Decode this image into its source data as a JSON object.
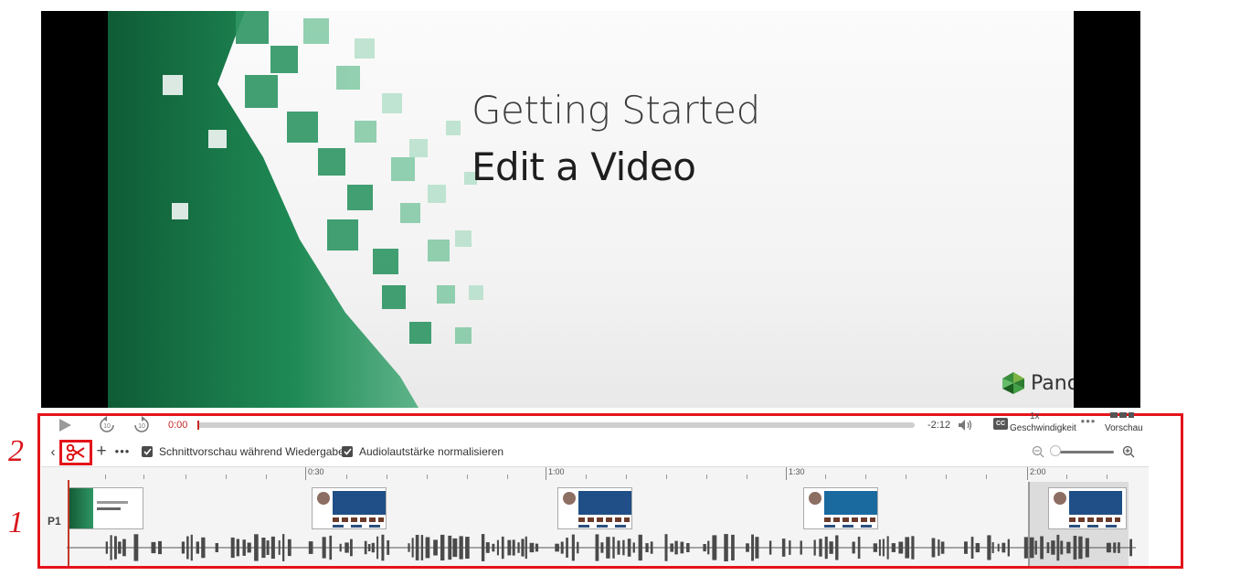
{
  "video": {
    "title_line1": "Getting Started",
    "title_line2": "Edit a Video",
    "brand": "Panopto"
  },
  "player": {
    "current_time": "0:00",
    "remaining_time": "-2:12",
    "progress": 0.0,
    "speed_value": "1x",
    "speed_label": "Geschwindigkeit",
    "layout_label": "Vorschau",
    "cc_label": "CC"
  },
  "toolbar": {
    "cut_preview_label": "Schnittvorschau während Wiedergabe",
    "cut_preview_checked": true,
    "normalize_audio_label": "Audiolautstärke normalisieren",
    "normalize_audio_checked": true
  },
  "timeline": {
    "ruler_labels": [
      "0:30",
      "1:00",
      "1:30",
      "2:00"
    ],
    "track_label": "P1"
  },
  "annotations": {
    "callout_1": "1",
    "callout_2": "2"
  },
  "colors": {
    "annotation": "#e4141a",
    "progress": "#c62828",
    "slide_green": "#1f7a4d"
  }
}
